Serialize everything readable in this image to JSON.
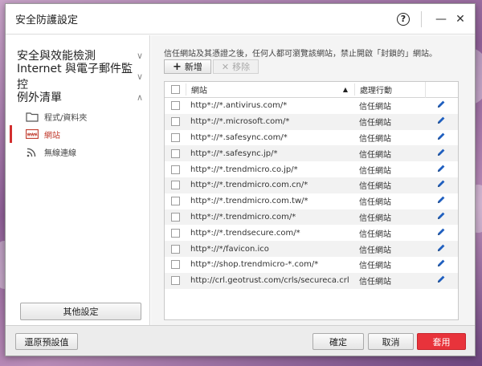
{
  "window": {
    "title": "安全防護設定",
    "help_glyph": "?",
    "minimize_glyph": "—",
    "close_glyph": "✕"
  },
  "sidebar": {
    "categories": [
      {
        "label": "安全與效能檢測",
        "chevron": "∨"
      },
      {
        "label": "Internet 與電子郵件監控",
        "chevron": "∨"
      },
      {
        "label": "例外清單",
        "chevron": "∧"
      }
    ],
    "subitems": [
      {
        "label": "程式/資料夾",
        "icon": "folder-icon"
      },
      {
        "label": "網站",
        "icon": "www-icon",
        "active": true
      },
      {
        "label": "無線連線",
        "icon": "wifi-icon"
      }
    ],
    "other_settings": "其他設定"
  },
  "main": {
    "description": "信任網站及其憑證之後，任何人都可瀏覽該網站，禁止開啟「封鎖的」網站。",
    "add_label": "新增",
    "add_glyph": "+",
    "remove_label": "移除",
    "remove_glyph": "✕",
    "columns": {
      "site": "網站",
      "action": "處理行動",
      "sort_glyph": "▲"
    },
    "rows": [
      {
        "url": "http*://*.antivirus.com/*",
        "action": "信任網站"
      },
      {
        "url": "http*://*.microsoft.com/*",
        "action": "信任網站"
      },
      {
        "url": "http*://*.safesync.com/*",
        "action": "信任網站"
      },
      {
        "url": "http*://*.safesync.jp/*",
        "action": "信任網站"
      },
      {
        "url": "http*://*.trendmicro.co.jp/*",
        "action": "信任網站"
      },
      {
        "url": "http*://*.trendmicro.com.cn/*",
        "action": "信任網站"
      },
      {
        "url": "http*://*.trendmicro.com.tw/*",
        "action": "信任網站"
      },
      {
        "url": "http*://*.trendmicro.com/*",
        "action": "信任網站"
      },
      {
        "url": "http*://*.trendsecure.com/*",
        "action": "信任網站"
      },
      {
        "url": "http*://*/favicon.ico",
        "action": "信任網站"
      },
      {
        "url": "http*://shop.trendmicro-*.com/*",
        "action": "信任網站"
      },
      {
        "url": "http://crl.geotrust.com/crls/secureca.crl",
        "action": "信任網站"
      }
    ]
  },
  "footer": {
    "restore_defaults": "還原預設值",
    "ok": "確定",
    "cancel": "取消",
    "apply": "套用"
  },
  "colors": {
    "accent_red": "#e8333b",
    "active_text": "#c0392b",
    "pencil_blue": "#1f5fbf"
  }
}
